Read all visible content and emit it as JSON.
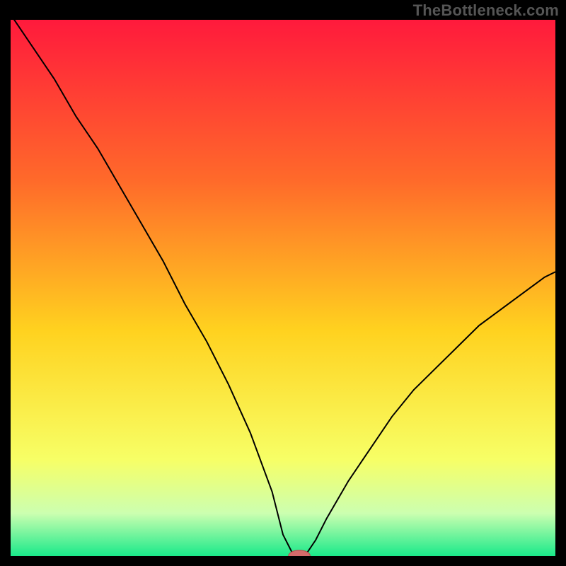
{
  "watermark": "TheBottleneck.com",
  "colors": {
    "frame": "#000000",
    "grad_top": "#ff1a3c",
    "grad_mid1": "#ff6a2a",
    "grad_mid2": "#ffd21f",
    "grad_mid3": "#f7ff66",
    "grad_mid4": "#ccffb0",
    "grad_bottom": "#19e98a",
    "curve": "#000000",
    "marker_fill": "#d46a6a",
    "marker_stroke": "#b44f4f"
  },
  "chart_data": {
    "type": "line",
    "title": "",
    "xlabel": "",
    "ylabel": "",
    "xlim": [
      0,
      100
    ],
    "ylim": [
      0,
      100
    ],
    "grid": false,
    "x": [
      0,
      4,
      8,
      12,
      16,
      20,
      24,
      28,
      32,
      36,
      40,
      44,
      48,
      50,
      52,
      53,
      54,
      56,
      58,
      62,
      66,
      70,
      74,
      78,
      82,
      86,
      90,
      94,
      98,
      100
    ],
    "values": [
      101,
      95,
      89,
      82,
      76,
      69,
      62,
      55,
      47,
      40,
      32,
      23,
      12,
      4,
      0,
      0,
      0,
      3,
      7,
      14,
      20,
      26,
      31,
      35,
      39,
      43,
      46,
      49,
      52,
      53
    ],
    "marker": {
      "x": 53,
      "y": 0,
      "rx": 2.0,
      "ry": 1.1
    }
  }
}
